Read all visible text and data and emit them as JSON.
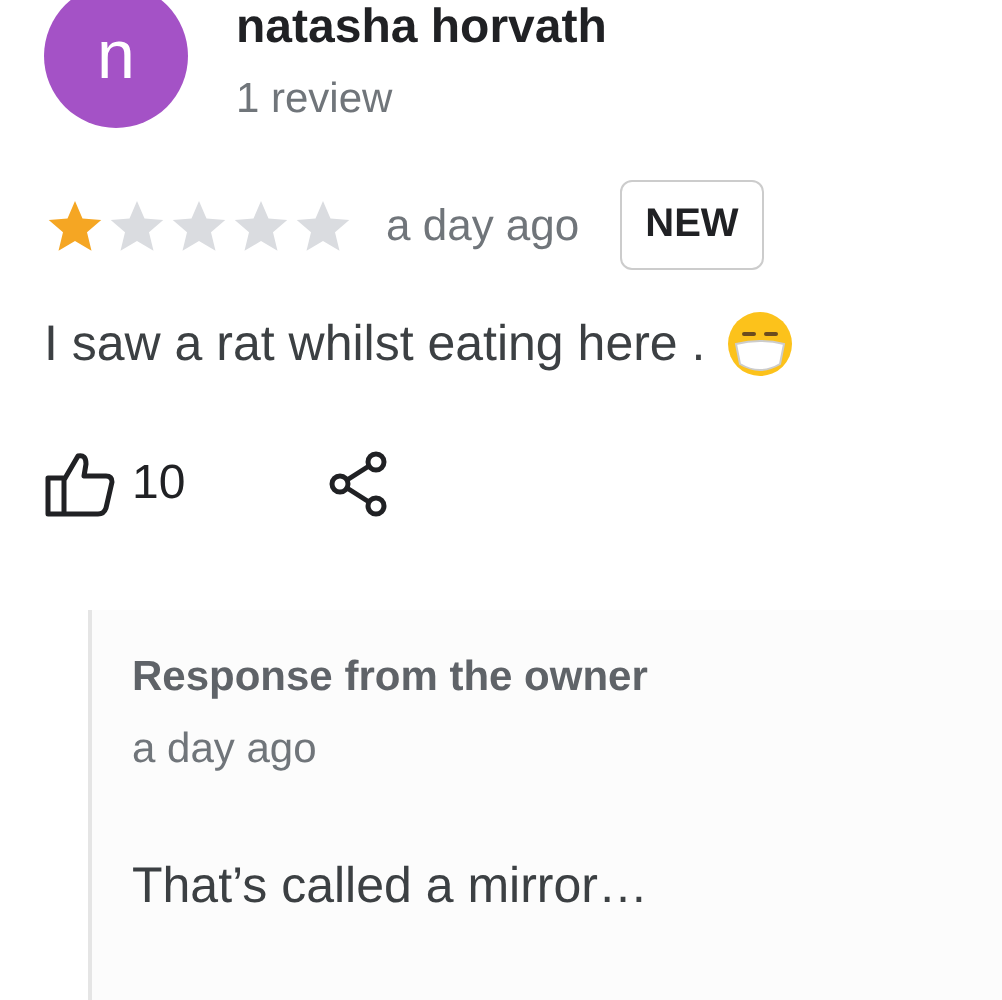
{
  "reviewer": {
    "initial": "n",
    "name": "natasha horvath",
    "count": "1 review"
  },
  "review": {
    "stars": 1,
    "time": "a day ago",
    "badge": "NEW",
    "text": "I saw a rat whilst eating here ."
  },
  "actions": {
    "likes": "10"
  },
  "response": {
    "title": "Response from the owner",
    "time": "a day ago",
    "text": "That’s called a mirror…"
  }
}
